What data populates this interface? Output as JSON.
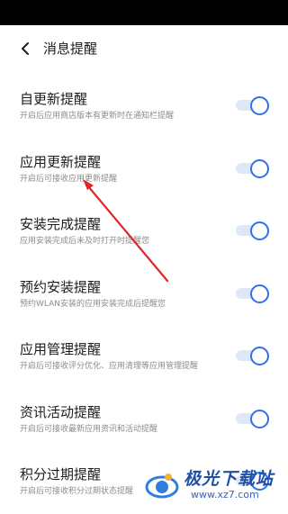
{
  "header": {
    "back_icon": "chevron-left-icon",
    "title": "消息提醒"
  },
  "settings": [
    {
      "title": "自更新提醒",
      "desc": "开启后应用商店版本有更新时在通知栏提醒",
      "enabled": true
    },
    {
      "title": "应用更新提醒",
      "desc": "开启后可接收应用更新提醒",
      "enabled": true
    },
    {
      "title": "安装完成提醒",
      "desc": "应用安装完成后未及时打开时提醒您",
      "enabled": true
    },
    {
      "title": "预约安装提醒",
      "desc": "预约WLAN安装的应用安装完成后提醒您",
      "enabled": true
    },
    {
      "title": "应用管理提醒",
      "desc": "开启后可接收评分优化、应用清理等应用管理提醒",
      "enabled": true
    },
    {
      "title": "资讯活动提醒",
      "desc": "开启后可接收最新应用资讯和活动提醒",
      "enabled": true
    },
    {
      "title": "积分过期提醒",
      "desc": "开启后可接收积分过期状态提醒",
      "enabled": true
    }
  ],
  "colors": {
    "accent": "#2f6ff2",
    "toggle_track": "#dfe8f6",
    "annotation_arrow": "#e0262a"
  },
  "watermark": {
    "logo_icon": "xz7-logo-icon",
    "name": "极光下载站",
    "url": "www.xz7.com"
  }
}
